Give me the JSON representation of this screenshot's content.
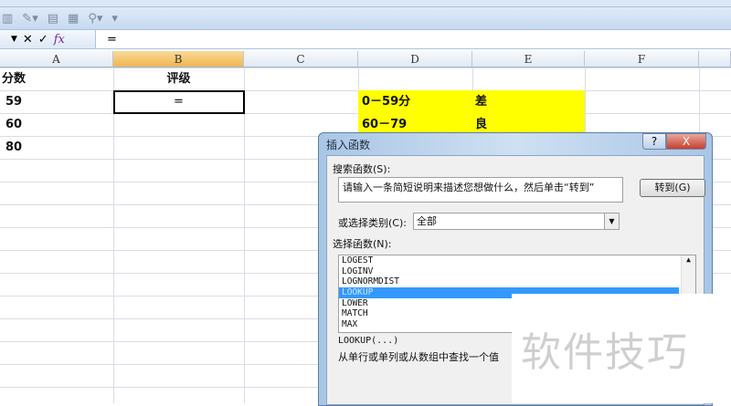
{
  "formula_bar": {
    "value": "="
  },
  "columns": [
    "A",
    "B",
    "C",
    "D",
    "E",
    "F"
  ],
  "cells": {
    "a1": "分数",
    "b1": "评级",
    "a2": "59",
    "b2": "=",
    "a3": "60",
    "a4": "80",
    "d2": "0－59分",
    "e2": "差",
    "d3": "60－79",
    "e3": "良"
  },
  "dialog": {
    "title": "插入函数",
    "help": "?",
    "close": "X",
    "search_label": "搜索函数(S):",
    "search_value": "请输入一条简短说明来描述您想做什么，然后单击“转到”",
    "goto": "转到(G)",
    "category_label": "或选择类别(C):",
    "category_value": "全部",
    "functions_label": "选择函数(N):",
    "functions": [
      "LOGEST",
      "LOGINV",
      "LOGNORMDIST",
      "LOOKUP",
      "LOWER",
      "MATCH",
      "MAX"
    ],
    "selected_signature": "LOOKUP(...)",
    "description": "从单行或单列或从数组中查找一个值"
  },
  "watermark": "软件技巧",
  "colors": {
    "highlight": "#ffff00",
    "selection": "#3399ff"
  }
}
